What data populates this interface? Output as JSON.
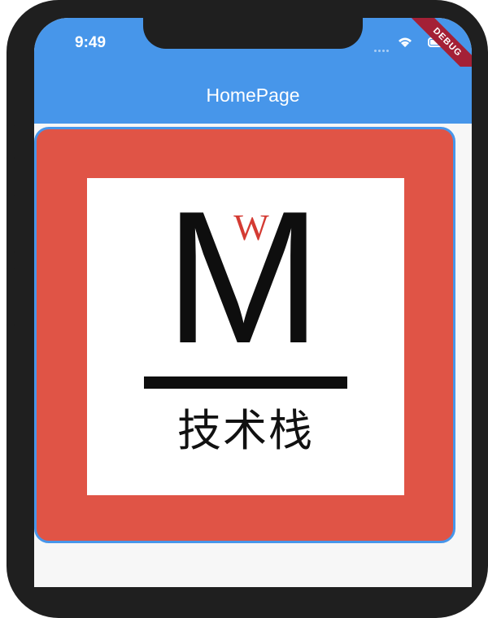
{
  "status_bar": {
    "time": "9:49",
    "debug_label": "DEBUG"
  },
  "appbar": {
    "title": "HomePage"
  },
  "logo": {
    "letter": "M",
    "superscript": "W",
    "caption": "技术栈"
  },
  "colors": {
    "primary": "#4796ea",
    "card": "#e05446",
    "logo_accent": "#d43b33"
  }
}
